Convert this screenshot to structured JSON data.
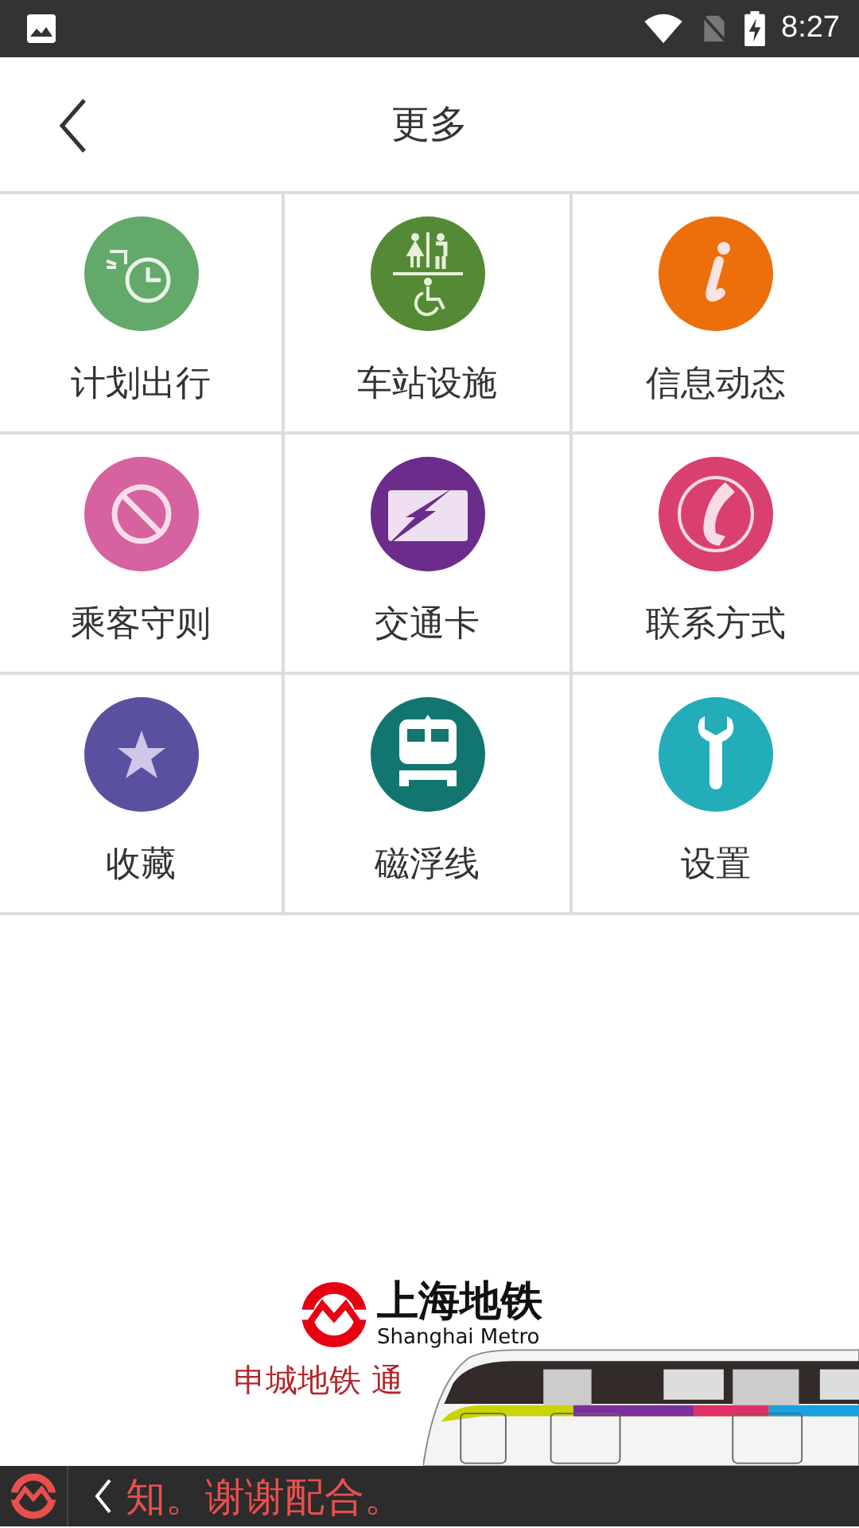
{
  "status_bar": {
    "time": "8:27"
  },
  "header": {
    "title": "更多"
  },
  "menu": [
    {
      "label": "计划出行",
      "color": "#63a96a"
    },
    {
      "label": "车站设施",
      "color": "#548a35"
    },
    {
      "label": "信息动态",
      "color": "#ec6f0c"
    },
    {
      "label": "乘客守则",
      "color": "#d662a0"
    },
    {
      "label": "交通卡",
      "color": "#6b2c8c"
    },
    {
      "label": "联系方式",
      "color": "#d9406e"
    },
    {
      "label": "收藏",
      "color": "#5a50a0"
    },
    {
      "label": "磁浮线",
      "color": "#13756f"
    },
    {
      "label": "设置",
      "color": "#22adb9"
    }
  ],
  "banner": {
    "brand": "上海地铁",
    "brand_en": "Shanghai Metro",
    "slogan": "申城地铁 通",
    "kind": "picture"
  },
  "ticker": {
    "text": "知。谢谢配合。"
  }
}
